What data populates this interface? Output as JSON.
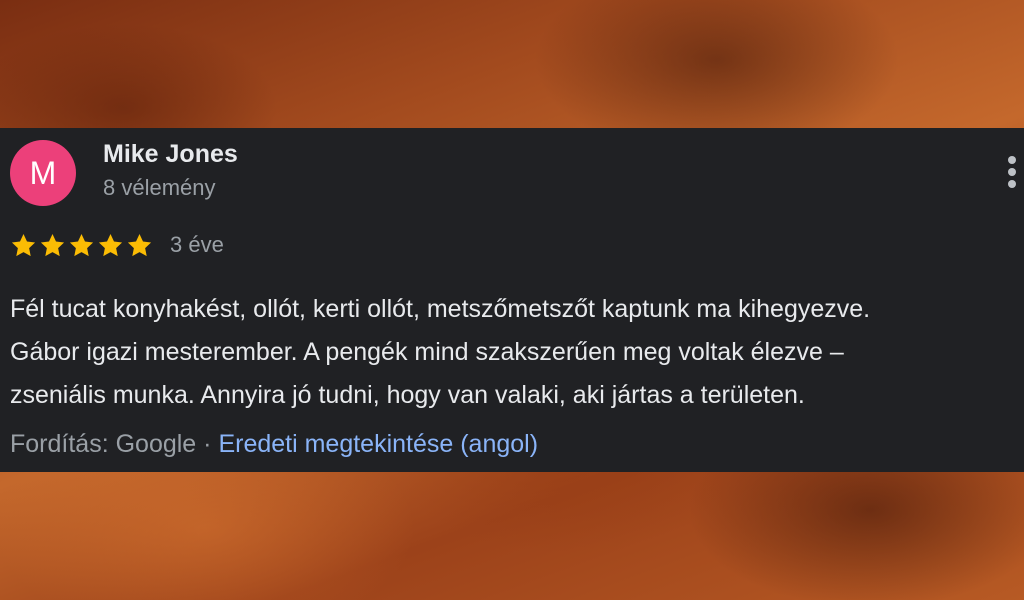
{
  "colors": {
    "card_bg": "#202124",
    "avatar_bg": "#ec407a",
    "star": "#fbbc04",
    "link": "#8ab4f8",
    "secondary_text": "#9aa0a6",
    "primary_text": "#e8eaed"
  },
  "review": {
    "avatar_letter": "M",
    "author": "Mike Jones",
    "review_count": "8 vélemény",
    "rating": 5,
    "time": "3 éve",
    "text_lines": [
      "Fél tucat konyhakést, ollót, kerti ollót, metszőmetszőt kaptunk ma kihegyezve.",
      "Gábor igazi mesterember. A pengék mind szakszerűen meg voltak élezve –",
      "zseniális munka. Annyira jó tudni, hogy van valaki, aki jártas a területen."
    ],
    "translated_by": "Fordítás: Google",
    "separator": " · ",
    "view_original": "Eredeti megtekintése (angol)",
    "more_icon": "more-vert-icon"
  }
}
